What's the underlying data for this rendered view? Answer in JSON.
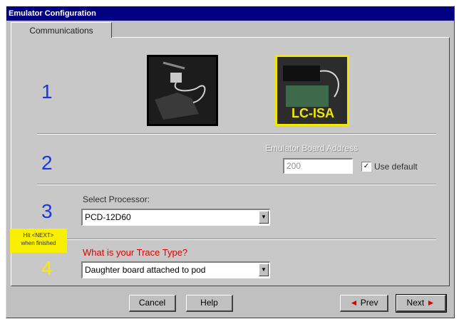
{
  "window": {
    "title": "Emulator Configuration"
  },
  "tabs": [
    {
      "label": "Communications",
      "selected": true
    }
  ],
  "steps": {
    "step1": "1",
    "step2": "2",
    "step3": "3",
    "step4": "4"
  },
  "hardware": {
    "left_photo_icon": "pod-cable-photo",
    "right_photo_icon": "isa-card-photo",
    "right_photo_label": "LC-ISA"
  },
  "emulator_board": {
    "label": "Emulator Board Address",
    "address_value": "200",
    "use_default_label": "Use default",
    "use_default_checked": true
  },
  "processor": {
    "label": "Select Processor:",
    "selected": "PCD-12D60"
  },
  "trace": {
    "question": "What is your Trace Type?",
    "selected": "Daughter board attached to pod"
  },
  "sticker": {
    "line1": "Hit <NEXT>",
    "line2": "when finished"
  },
  "buttons": {
    "cancel": "Cancel",
    "help": "Help",
    "prev": "Prev",
    "next": "Next"
  },
  "colors": {
    "titlebar": "#000080",
    "step_number": "#1838e8",
    "highlight": "#ffe800",
    "question": "#e00000"
  }
}
